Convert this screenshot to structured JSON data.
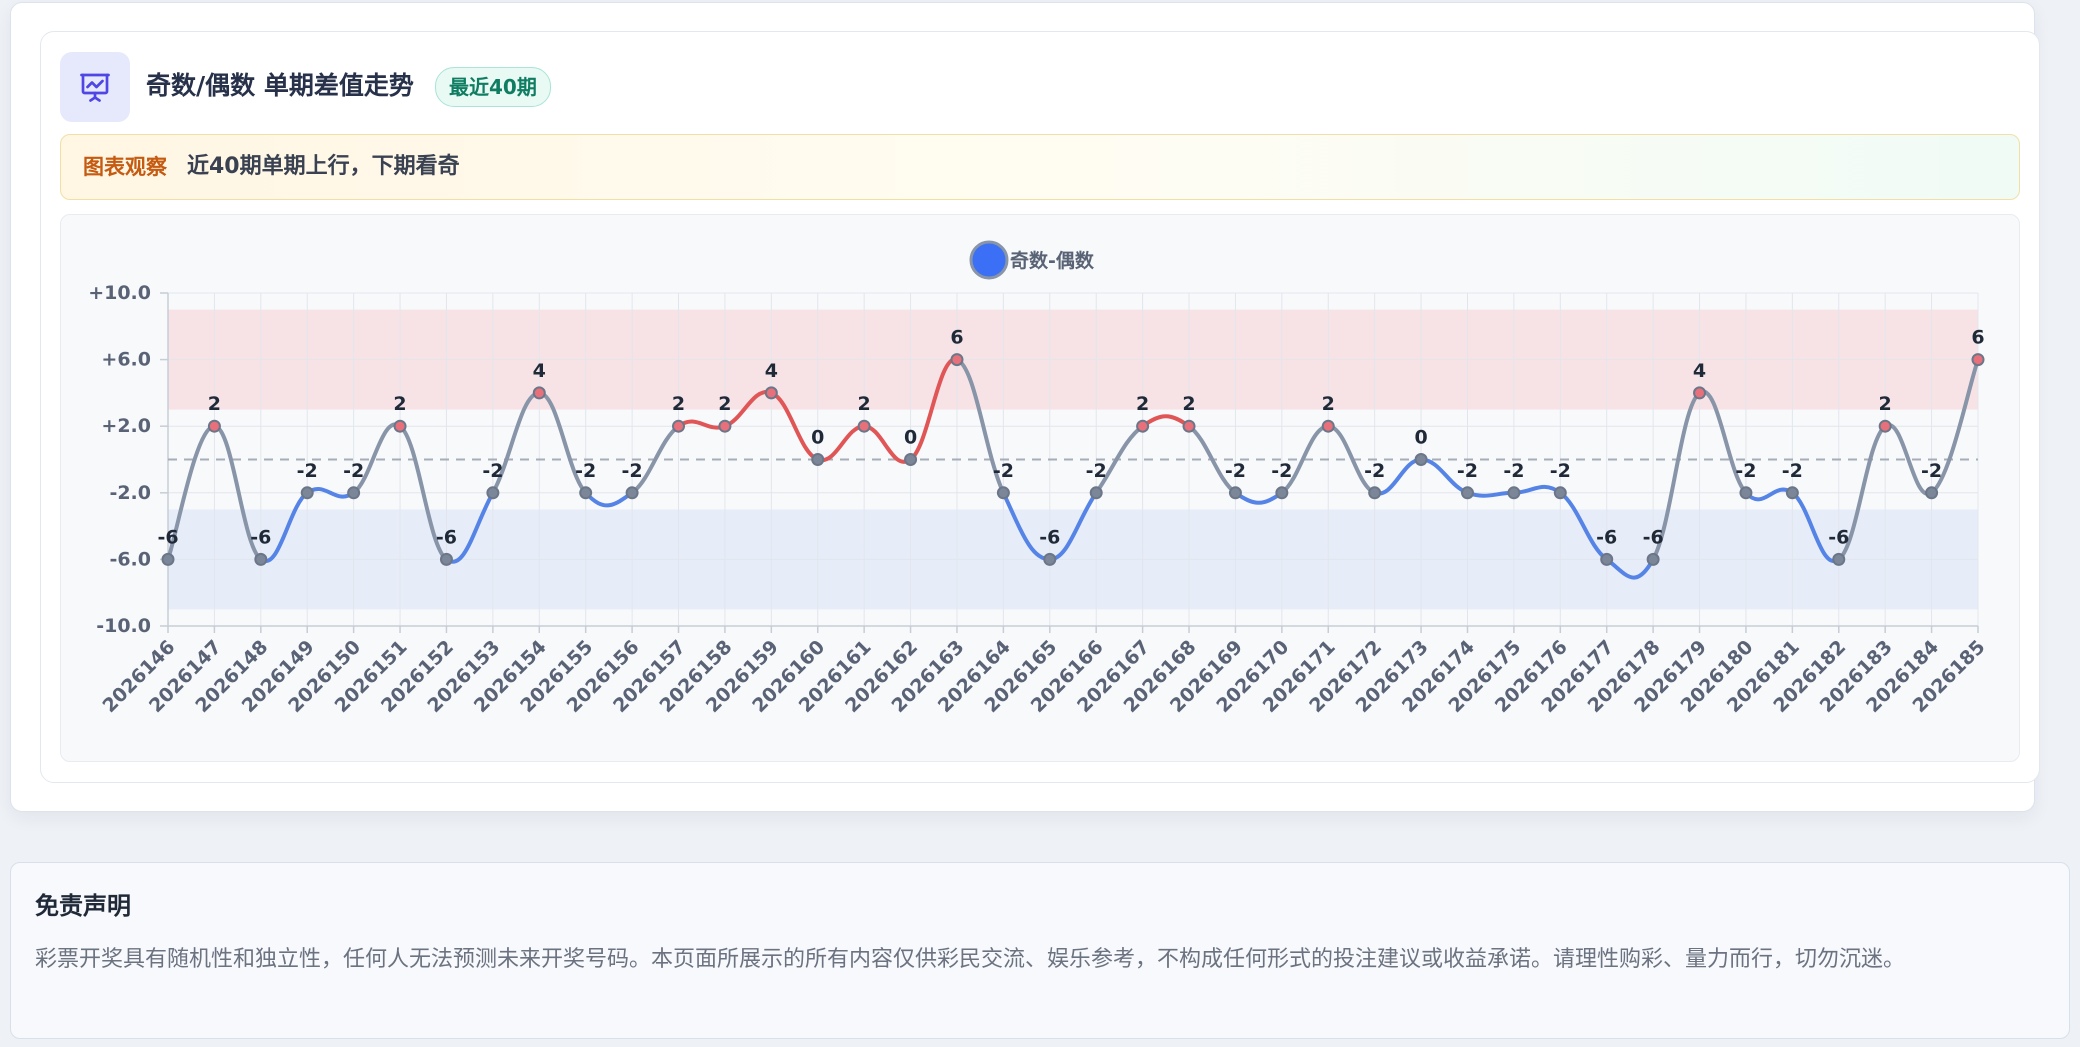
{
  "header": {
    "title": "奇数/偶数 单期差值走势",
    "badge": "最近40期"
  },
  "observation": {
    "label": "图表观察",
    "text": "近40期单期上行，下期看奇"
  },
  "disclaimer": {
    "title": "免责声明",
    "text": "彩票开奖具有随机性和独立性，任何人无法预测未来开奖号码。本页面所展示的所有内容仅供彩民交流、娱乐参考，不构成任何形式的投注建议或收益承诺。请理性购彩、量力而行，切勿沉迷。"
  },
  "colors": {
    "up": "#e05656",
    "down": "#5584e6",
    "neutral": "#8895a8",
    "legend": "#3b6ff5",
    "upper_band": "#f7e3e6",
    "lower_band": "#e7ecf9"
  },
  "icons": {
    "header": "presentation-chart-icon"
  },
  "chart_data": {
    "type": "line",
    "legend": "奇数-偶数",
    "legend_position": "top-center",
    "x": [
      "2026146",
      "2026147",
      "2026148",
      "2026149",
      "2026150",
      "2026151",
      "2026152",
      "2026153",
      "2026154",
      "2026155",
      "2026156",
      "2026157",
      "2026158",
      "2026159",
      "2026160",
      "2026161",
      "2026162",
      "2026163",
      "2026164",
      "2026165",
      "2026166",
      "2026167",
      "2026168",
      "2026169",
      "2026170",
      "2026171",
      "2026172",
      "2026173",
      "2026174",
      "2026175",
      "2026176",
      "2026177",
      "2026178",
      "2026179",
      "2026180",
      "2026181",
      "2026182",
      "2026183",
      "2026184",
      "2026185"
    ],
    "series": [
      {
        "name": "奇数-偶数",
        "values": [
          -6,
          2,
          -6,
          -2,
          -2,
          2,
          -6,
          -2,
          4,
          -2,
          -2,
          2,
          2,
          4,
          0,
          2,
          0,
          6,
          -2,
          -6,
          -2,
          2,
          2,
          -2,
          -2,
          2,
          -2,
          0,
          -2,
          -2,
          -2,
          -6,
          -6,
          4,
          -2,
          -2,
          -6,
          2,
          -2,
          6
        ]
      }
    ],
    "yticks": [
      "+10.0",
      "+6.0",
      "+2.0",
      "-2.0",
      "-6.0",
      "-10.0"
    ],
    "ytick_values": [
      10,
      6,
      2,
      -2,
      -6,
      -10
    ],
    "ylim": [
      -10,
      10
    ],
    "bands": [
      {
        "from": 3,
        "to": 9
      },
      {
        "from": -9,
        "to": -3
      }
    ],
    "reference_line": 0,
    "grid": true,
    "data_labels": true
  }
}
